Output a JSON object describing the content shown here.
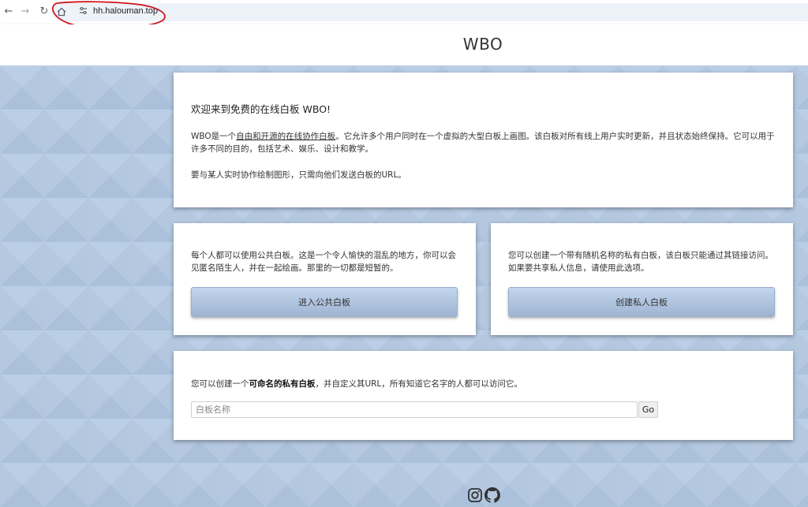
{
  "browser": {
    "url": "hh.halouman.top",
    "back_icon": "back-arrow-icon",
    "forward_icon": "forward-arrow-icon",
    "reload_icon": "reload-icon",
    "home_icon": "home-icon"
  },
  "header": {
    "title": "WBO"
  },
  "intro": {
    "heading": "欢迎来到免费的在线白板 WBO!",
    "p1_prefix": "WBO是一个",
    "p1_link": "自由和开源的在线协作白板",
    "p1_suffix": "。它允许多个用户同时在一个虚拟的大型白板上画图。该白板对所有线上用户实时更新，并且状态始终保持。它可以用于许多不同的目的，包括艺术、娱乐、设计和教学。",
    "p2": "要与某人实时协作绘制图形，只需向他们发送白板的URL。"
  },
  "public_board": {
    "description": "每个人都可以使用公共白板。这是一个令人愉快的混乱的地方，你可以会见匿名陌生人，并在一起绘画。那里的一切都是短暂的。",
    "button_label": "进入公共白板"
  },
  "private_board": {
    "description": "您可以创建一个带有随机名称的私有白板，该白板只能通过其链接访问。如果要共享私人信息，请使用此选项。",
    "button_label": "创建私人白板"
  },
  "named_board": {
    "text_prefix": "您可以创建一个",
    "text_bold": "可命名的私有白板",
    "text_suffix": "，并自定义其URL，所有知道它名字的人都可以访问它。",
    "input_placeholder": "白板名称",
    "go_label": "Go"
  },
  "colors": {
    "background": "#b2c6de",
    "button_top": "#c3d6ef",
    "button_bottom": "#9eb4d1",
    "annotation": "#d0161e"
  }
}
